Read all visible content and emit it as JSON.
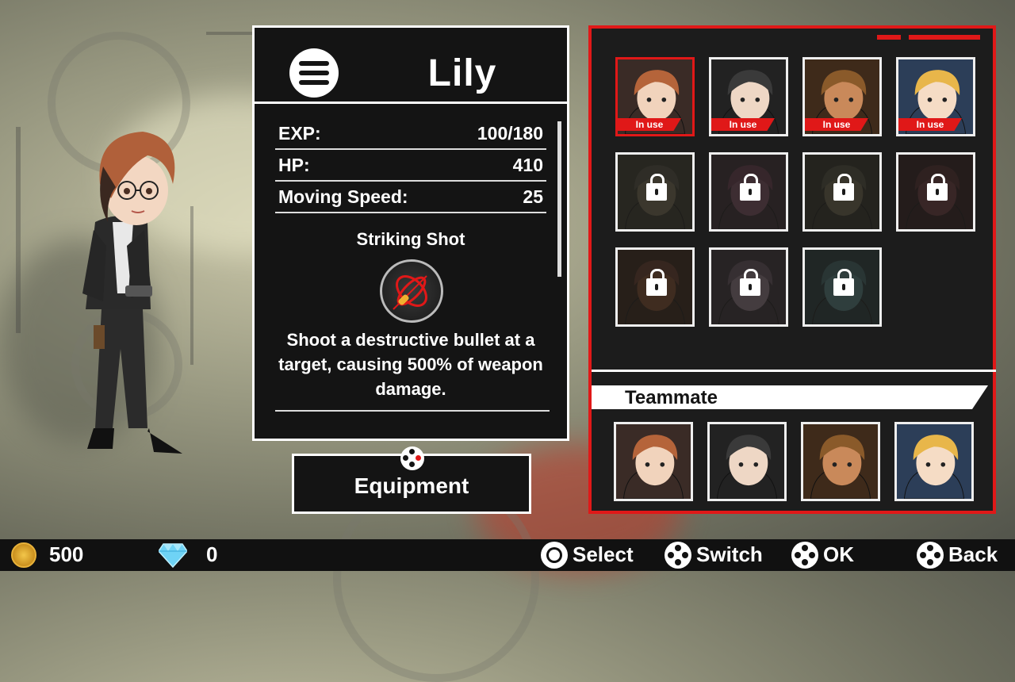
{
  "character": {
    "name": "Lily",
    "stats": [
      {
        "label": "EXP:",
        "value": "100/180"
      },
      {
        "label": "HP:",
        "value": "410"
      },
      {
        "label": "Moving Speed:",
        "value": "25"
      }
    ],
    "skill": {
      "name": "Striking Shot",
      "description": "Shoot a destructive bullet at a target, causing 500% of weapon damage.",
      "icon": "bullet-target-icon"
    }
  },
  "equipment_label": "Equipment",
  "roster": {
    "in_use_label": "In use",
    "slots": [
      {
        "id": "lily",
        "state": "in_use",
        "selected": true,
        "palette": [
          "#b5643a",
          "#f1d3bc",
          "#3a2b26"
        ]
      },
      {
        "id": "detective",
        "state": "in_use",
        "selected": false,
        "palette": [
          "#3a3a3a",
          "#eed7c5",
          "#222"
        ]
      },
      {
        "id": "cowboy",
        "state": "in_use",
        "selected": false,
        "palette": [
          "#8a5a2a",
          "#c9895a",
          "#3e2a1a"
        ]
      },
      {
        "id": "blonde",
        "state": "in_use",
        "selected": false,
        "palette": [
          "#e8b64a",
          "#f5dcc5",
          "#2c3e58"
        ]
      },
      {
        "id": "locked-1",
        "state": "locked",
        "palette": [
          "#3a3a30",
          "#55503e",
          "#2a2a22"
        ]
      },
      {
        "id": "locked-2",
        "state": "locked",
        "palette": [
          "#4a2a3a",
          "#5a3a48",
          "#2a1e26"
        ]
      },
      {
        "id": "locked-3",
        "state": "locked",
        "palette": [
          "#38382e",
          "#4e4a3a",
          "#22221c"
        ]
      },
      {
        "id": "locked-4",
        "state": "locked",
        "palette": [
          "#3a1e22",
          "#4e2a2e",
          "#221416"
        ]
      },
      {
        "id": "locked-5",
        "state": "locked",
        "palette": [
          "#4a2a1e",
          "#5e3622",
          "#2a1a12"
        ]
      },
      {
        "id": "locked-6",
        "state": "locked",
        "palette": [
          "#4a3e48",
          "#6a5a66",
          "#2a222a"
        ]
      },
      {
        "id": "locked-7",
        "state": "locked",
        "palette": [
          "#2e4a4e",
          "#3a5e62",
          "#1a2a2c"
        ]
      }
    ],
    "teammate_label": "Teammate",
    "teammates": [
      {
        "id": "lily",
        "palette": [
          "#b5643a",
          "#f1d3bc",
          "#3a2b26"
        ]
      },
      {
        "id": "detective",
        "palette": [
          "#3a3a3a",
          "#eed7c5",
          "#222"
        ]
      },
      {
        "id": "cowboy",
        "palette": [
          "#8a5a2a",
          "#c9895a",
          "#3e2a1a"
        ]
      },
      {
        "id": "blonde",
        "palette": [
          "#e8b64a",
          "#f5dcc5",
          "#2c3e58"
        ]
      }
    ]
  },
  "currency": {
    "gold": "500",
    "gems": "0"
  },
  "controls": {
    "select": "Select",
    "switch": "Switch",
    "ok": "OK",
    "back": "Back"
  },
  "colors": {
    "accent_red": "#e01818",
    "panel_dark": "#141414"
  }
}
